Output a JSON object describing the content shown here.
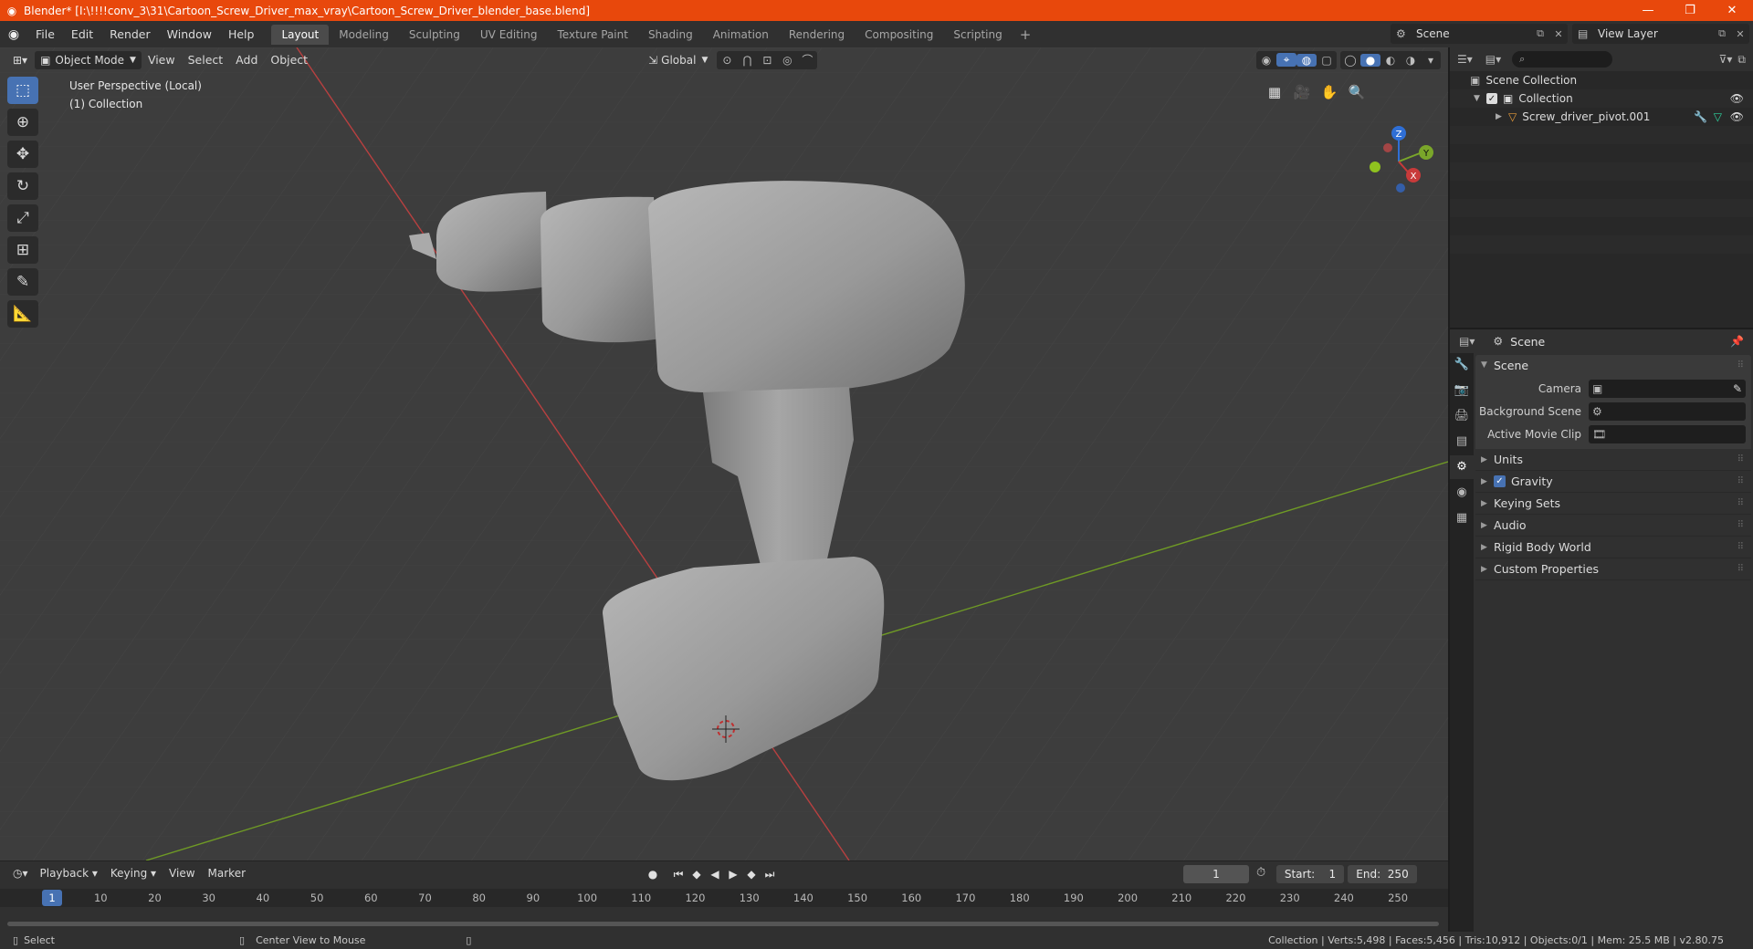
{
  "window": {
    "title": "Blender* [I:\\!!!!conv_3\\31\\Cartoon_Screw_Driver_max_vray\\Cartoon_Screw_Driver_blender_base.blend]",
    "minimize": "—",
    "maximize": "❐",
    "close": "✕"
  },
  "menu": [
    "File",
    "Edit",
    "Render",
    "Window",
    "Help"
  ],
  "workspaces": [
    "Layout",
    "Modeling",
    "Sculpting",
    "UV Editing",
    "Texture Paint",
    "Shading",
    "Animation",
    "Rendering",
    "Compositing",
    "Scripting"
  ],
  "active_workspace": "Layout",
  "scene_selector": "Scene",
  "view_layer_selector": "View Layer",
  "viewport": {
    "mode": "Object Mode",
    "menus": [
      "View",
      "Select",
      "Add",
      "Object"
    ],
    "orientation": "Global",
    "info_line1": "User Perspective (Local)",
    "info_line2": "(1) Collection",
    "gizmo": {
      "x": "X",
      "y": "Y",
      "z": "Z"
    }
  },
  "timeline": {
    "menus": [
      "Playback",
      "Keying",
      "View",
      "Marker"
    ],
    "current_frame": "1",
    "start_label": "Start:",
    "start": "1",
    "end_label": "End:",
    "end": "250",
    "ticks": [
      "10",
      "20",
      "30",
      "40",
      "50",
      "60",
      "70",
      "80",
      "90",
      "100",
      "110",
      "120",
      "130",
      "140",
      "150",
      "160",
      "170",
      "180",
      "190",
      "200",
      "210",
      "220",
      "230",
      "240",
      "250"
    ]
  },
  "outliner": {
    "root": "Scene Collection",
    "collection": "Collection",
    "object": "Screw_driver_pivot.001"
  },
  "properties": {
    "header": "Scene",
    "panel": "Scene",
    "camera_label": "Camera",
    "background_scene_label": "Background Scene",
    "movie_clip_label": "Active Movie Clip",
    "subpanels": [
      "Units",
      "Gravity",
      "Keying Sets",
      "Audio",
      "Rigid Body World",
      "Custom Properties"
    ]
  },
  "status": {
    "left_action": "Select",
    "mid_action": "Center View to Mouse",
    "stats": "Collection | Verts:5,498 | Faces:5,456 | Tris:10,912 | Objects:0/1 | Mem: 25.5 MB | v2.80.75"
  },
  "colors": {
    "titlebar": "#e8480c",
    "accent": "#4772b3",
    "x_axis": "#c83a3a",
    "y_axis": "#7aa62a",
    "viewport_bg": "#3d3d3d"
  }
}
